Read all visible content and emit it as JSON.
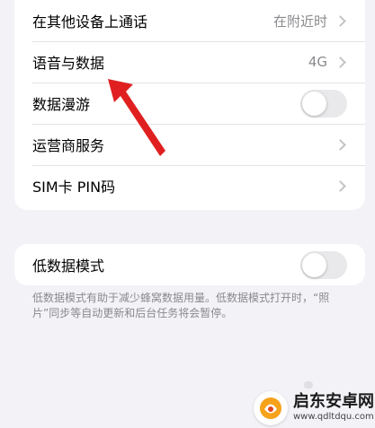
{
  "settings": {
    "rows": [
      {
        "label": "在其他设备上通话",
        "value": "在附近时",
        "type": "chevron"
      },
      {
        "label": "语音与数据",
        "value": "4G",
        "type": "chevron"
      },
      {
        "label": "数据漫游",
        "value": "",
        "type": "toggle",
        "on": false
      },
      {
        "label": "运营商服务",
        "value": "",
        "type": "chevron"
      },
      {
        "label": "SIM卡 PIN码",
        "value": "",
        "type": "chevron"
      }
    ],
    "low_data": {
      "label": "低数据模式",
      "on": false,
      "footnote": "低数据模式有助于减少蜂窝数据用量。低数据模式打开时，“照片”同步等自动更新和后台任务将会暂停。"
    }
  },
  "watermark": {
    "title": "启东安卓网",
    "url": "www.qdltdqu.com"
  },
  "colors": {
    "background": "#f2f2f7",
    "arrow": "#e02020",
    "secondary_text": "#8a8a8e"
  }
}
